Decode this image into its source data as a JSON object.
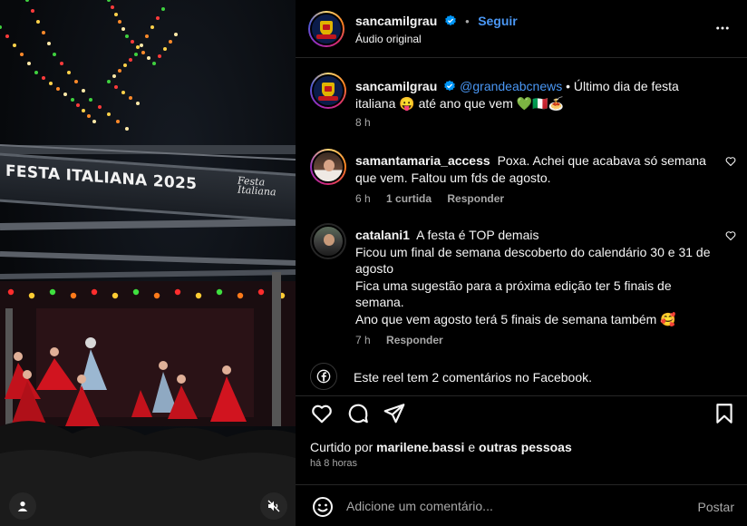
{
  "media": {
    "banner_text": "FESTA ITALIANA 2025",
    "banner_logo_line1": "Festa",
    "banner_logo_line2": "Italiana",
    "user_button_icon": "person-icon",
    "mute_button_icon": "muted-speaker-icon"
  },
  "header": {
    "username": "sancamilgrau",
    "verified_icon": "verified-badge-icon",
    "separator": "•",
    "follow_label": "Seguir",
    "audio_label": "Áudio original",
    "more_icon": "more-options-icon"
  },
  "caption": {
    "username": "sancamilgrau",
    "mention": "@grandeabcnews",
    "text": " • Último dia de festa italiana 😛 até ano que vem 💚🇮🇹🍝",
    "time": "8 h"
  },
  "comments": [
    {
      "username": "samantamaria_access",
      "text": "Poxa. Achei que acabava só semana que vem. Faltou um fds de agosto.",
      "time": "6 h",
      "likes": "1 curtida",
      "reply": "Responder"
    },
    {
      "username": "catalani1",
      "lines": [
        "A festa é TOP demais",
        "Ficou um final de semana descoberto do calendário 30 e 31 de agosto",
        "Fica uma sugestão para a próxima edição ter 5 finais de semana.",
        "Ano que vem agosto terá 5 finais de semana também 🥰"
      ],
      "time": "7 h",
      "reply": "Responder"
    }
  ],
  "facebook_note": "Este reel tem 2 comentários no Facebook.",
  "actions": {
    "like_icon": "heart-icon",
    "comment_icon": "comment-icon",
    "share_icon": "send-icon",
    "save_icon": "bookmark-icon"
  },
  "likes": {
    "prefix": "Curtido por ",
    "user": "marilene.bassi",
    "middle": " e ",
    "others": "outras pessoas"
  },
  "posted_time": "há 8 horas",
  "add_comment": {
    "placeholder": "Adicione um comentário...",
    "post_label": "Postar",
    "emoji_icon": "emoji-icon"
  },
  "colors": {
    "accent": "#4a97f4",
    "muted_text": "#a8a8a8",
    "divider": "#262626"
  }
}
